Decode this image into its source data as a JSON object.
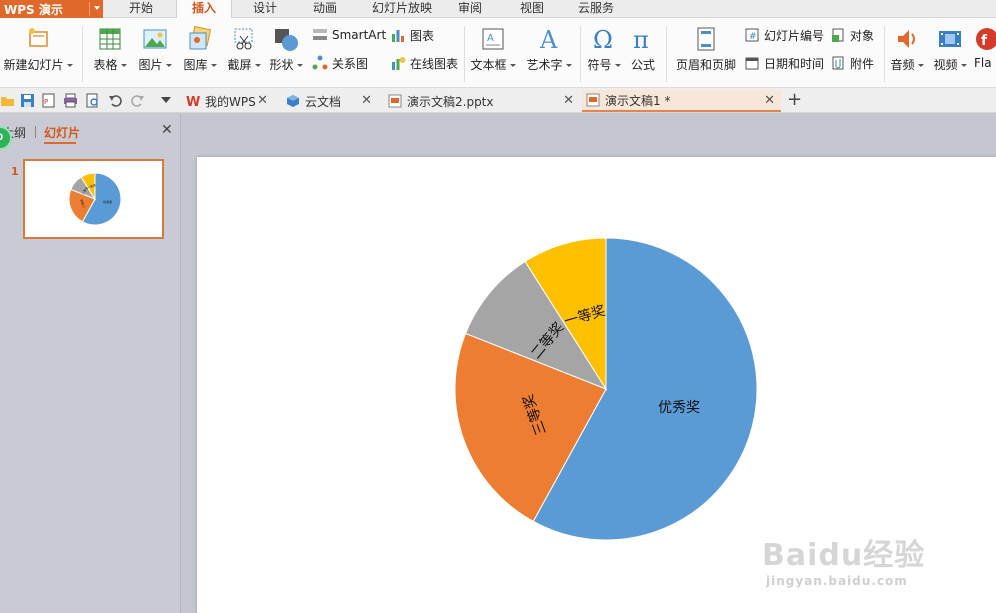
{
  "app": {
    "name": "WPS 演示"
  },
  "menu_tabs": [
    {
      "label": "开始"
    },
    {
      "label": "插入",
      "active": true
    },
    {
      "label": "设计"
    },
    {
      "label": "动画"
    },
    {
      "label": "幻灯片放映"
    },
    {
      "label": "审阅"
    },
    {
      "label": "视图"
    },
    {
      "label": "云服务"
    }
  ],
  "ribbon": {
    "new_slide": "新建幻灯片",
    "table": "表格",
    "picture": "图片",
    "gallery": "图库",
    "screenshot": "截屏",
    "shape": "形状",
    "smartart": "SmartArt",
    "relation": "关系图",
    "chart": "图表",
    "online_chart": "在线图表",
    "textbox": "文本框",
    "wordart": "艺术字",
    "symbol": "符号",
    "formula": "公式",
    "header_footer": "页眉和页脚",
    "slide_number": "幻灯片编号",
    "object": "对象",
    "datetime": "日期和时间",
    "attachment": "附件",
    "audio": "音频",
    "video": "视频",
    "flash": "Fla"
  },
  "doc_tabs": [
    {
      "label": "我的WPS"
    },
    {
      "label": "云文档"
    },
    {
      "label": "演示文稿2.pptx"
    },
    {
      "label": "演示文稿1 *",
      "active": true
    }
  ],
  "left_panel": {
    "tab_outline": "大纲",
    "tab_slides": "幻灯片",
    "slide_number": "1",
    "badge": "0"
  },
  "colors": {
    "accent": "#e0682a",
    "blue": "#5b9bd5",
    "orange": "#ed7d31",
    "gray": "#a5a5a5",
    "yellow": "#ffc000"
  },
  "chart_data": {
    "type": "pie",
    "categories": [
      "优秀奖",
      "三等奖",
      "二等奖",
      "一等奖"
    ],
    "values": [
      58,
      23,
      10,
      9
    ],
    "title": "",
    "legend": "none"
  },
  "watermark": {
    "brand": "Baidu经验",
    "url": "jingyan.baidu.com"
  }
}
